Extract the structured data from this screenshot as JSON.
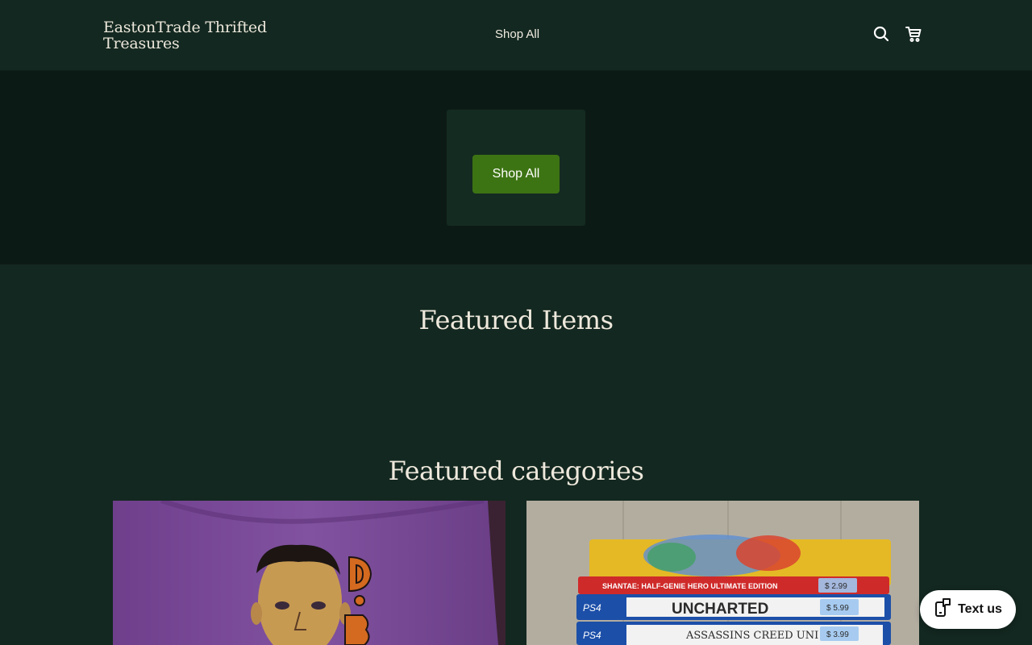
{
  "header": {
    "brand": "EastonTrade Thrifted Treasures",
    "nav": [
      "Shop All"
    ],
    "icons": [
      "search-icon",
      "cart-icon"
    ]
  },
  "hero": {
    "button_label": "Shop All"
  },
  "featured_items": {
    "title": "Featured Items"
  },
  "featured_categories": {
    "title": "Featured categories",
    "game_labels": [
      "SHANTAE: HALF-GENIE HERO ULTIMATE EDITION",
      "UNCHARTED",
      "ASSASSINS CREED UNI"
    ],
    "platform_labels": [
      "PS4",
      "PS4"
    ],
    "price_tags": [
      "$ 2.99",
      "$ 5.99",
      "$ 3.99"
    ]
  },
  "chat_widget": {
    "label": "Text us"
  },
  "colors": {
    "header_bg": "#132820",
    "hero_bg": "#0c1a15",
    "accent_button": "#3d7413",
    "text": "#eee8dc"
  }
}
